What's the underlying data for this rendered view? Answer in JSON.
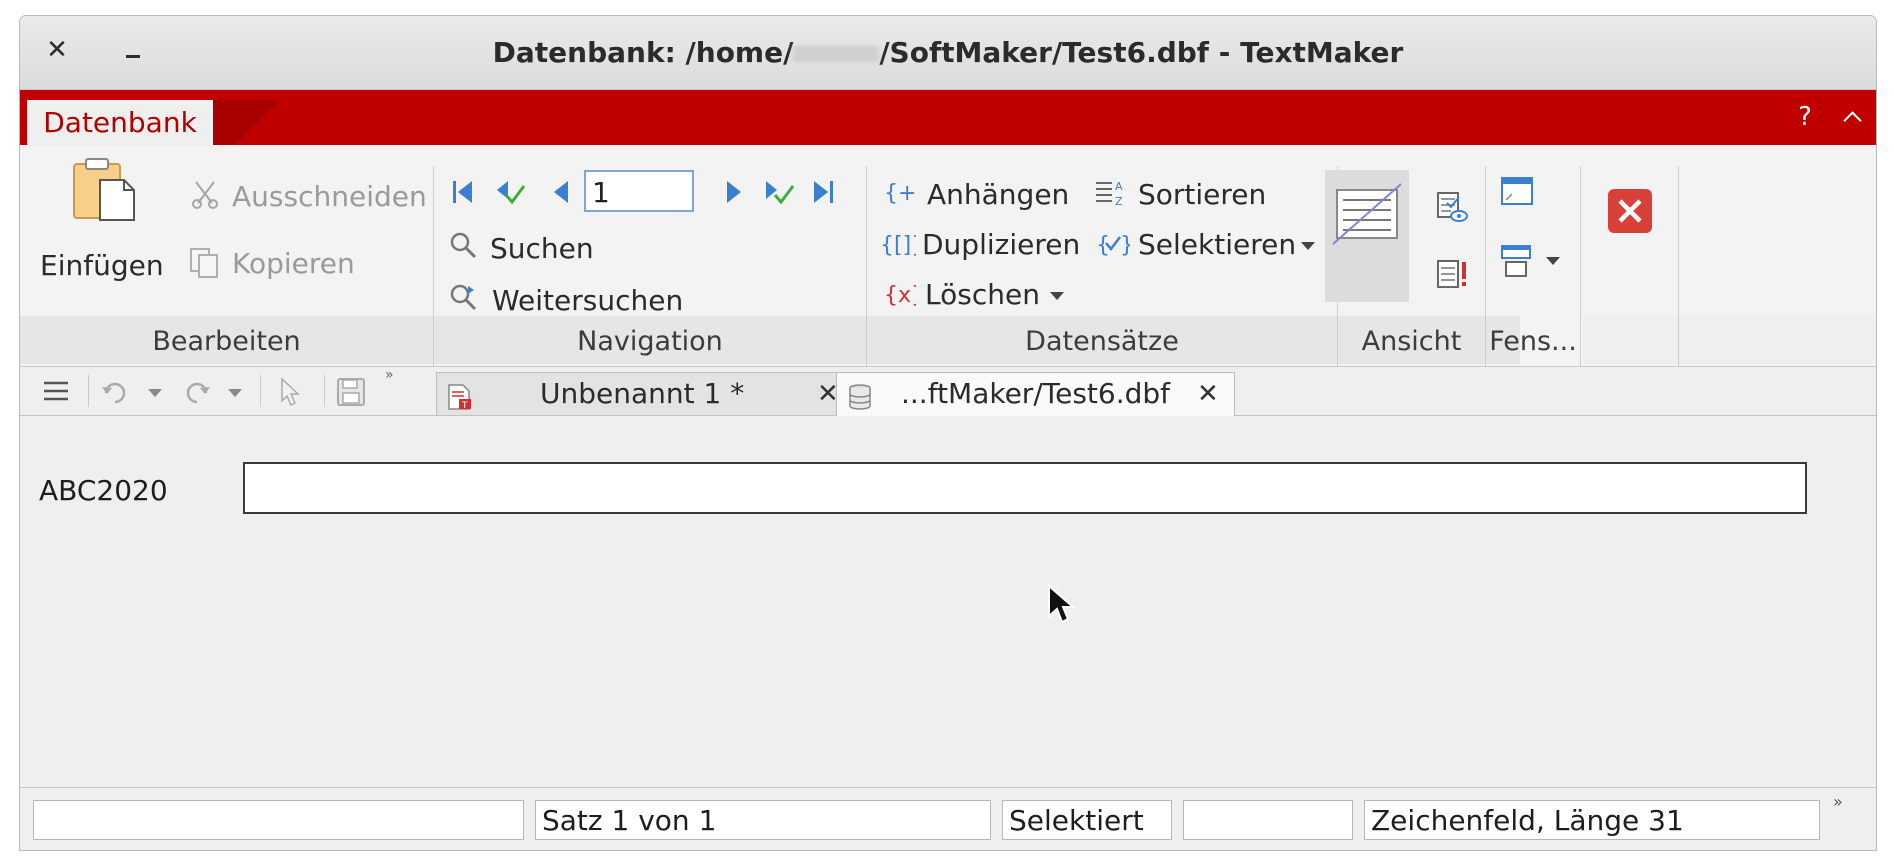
{
  "window": {
    "title_prefix": "Datenbank: /home/",
    "title_suffix": "/SoftMaker/Test6.dbf - TextMaker",
    "close_glyph": "✕",
    "minimize_label": ""
  },
  "ribbon": {
    "tab": "Datenbank",
    "help": "?",
    "groups": {
      "bearbeiten": "Bearbeiten",
      "navigation": "Navigation",
      "datensaetze": "Datensätze",
      "ansicht": "Ansicht",
      "fenster": "Fens..."
    },
    "bearbeiten": {
      "einfuegen": "Einfügen",
      "ausschneiden": "Ausschneiden",
      "kopieren": "Kopieren"
    },
    "navigation": {
      "record_value": "1",
      "suchen": "Suchen",
      "weitersuchen": "Weitersuchen"
    },
    "datensaetze": {
      "anhaengen": "Anhängen",
      "sortieren": "Sortieren",
      "duplizieren": "Duplizieren",
      "selektieren": "Selektieren",
      "loeschen": "Löschen"
    }
  },
  "tabs": [
    {
      "label": "Unbenannt 1 *",
      "close": "✕",
      "icon": "textmaker-document-icon"
    },
    {
      "label": "...ftMaker/Test6.dbf",
      "close": "✕",
      "icon": "database-icon"
    }
  ],
  "form": {
    "field_label": "ABC2020",
    "field_value": ""
  },
  "status": {
    "box1": "",
    "record": "Satz 1 von 1",
    "mode": "Selektiert",
    "box4": "",
    "field_info": "Zeichenfeld, Länge 31",
    "more": "»"
  },
  "colors": {
    "accent": "#c00000",
    "close_red": "#d9403a"
  }
}
